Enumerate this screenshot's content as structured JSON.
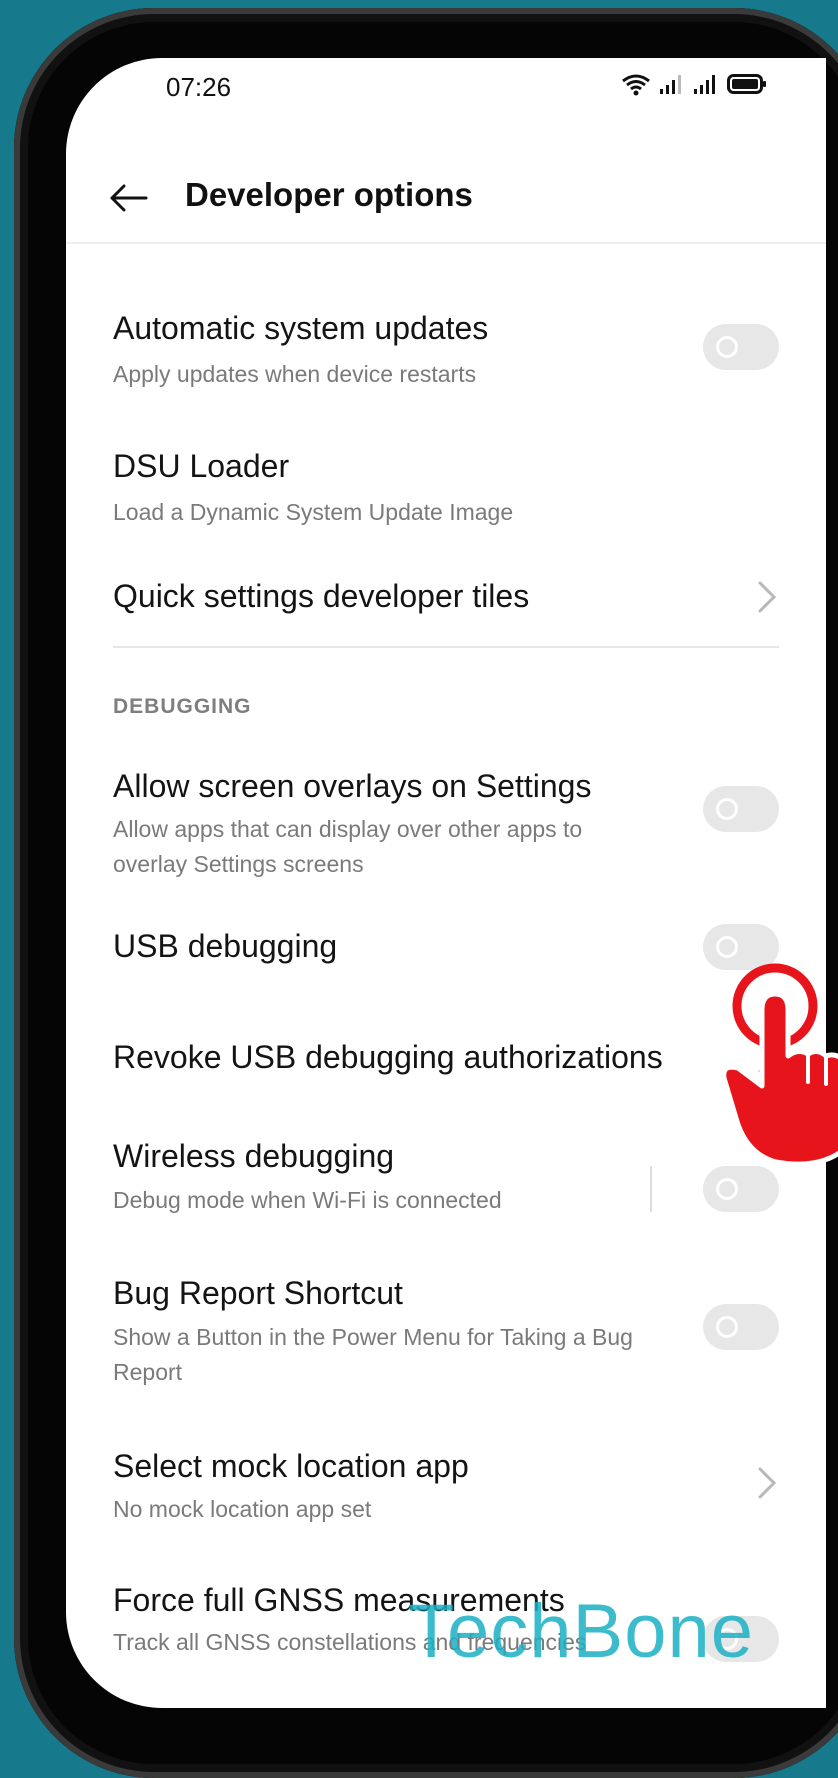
{
  "status_bar": {
    "time": "07:26",
    "icons": [
      "wifi-icon",
      "signal-icon",
      "signal-icon",
      "battery-icon"
    ]
  },
  "app_bar": {
    "back_icon": "back-arrow-icon",
    "title": "Developer options"
  },
  "items_top": [
    {
      "title": "Automatic system updates",
      "subtitle": "Apply updates when device restarts",
      "control": "toggle",
      "on": false
    },
    {
      "title": "DSU Loader",
      "subtitle": "Load a Dynamic System Update Image",
      "control": "none"
    },
    {
      "title": "Quick settings developer tiles",
      "subtitle": "",
      "control": "chevron"
    }
  ],
  "debugging": {
    "header": "DEBUGGING",
    "items": [
      {
        "title": "Allow screen overlays on Settings",
        "subtitle": "Allow apps that can display over other apps to overlay Settings screens",
        "control": "toggle",
        "on": false
      },
      {
        "title": "USB debugging",
        "subtitle": "",
        "control": "toggle",
        "on": false
      },
      {
        "title": "Revoke USB debugging authorizations",
        "subtitle": "",
        "control": "chevron"
      },
      {
        "title": "Wireless debugging",
        "subtitle": "Debug mode when Wi-Fi is connected",
        "control": "toggle",
        "on": false
      },
      {
        "title": "Bug Report Shortcut",
        "subtitle": "Show a Button in the Power Menu for Taking a Bug Report",
        "control": "toggle",
        "on": false
      },
      {
        "title": "Select mock location app",
        "subtitle": "No mock location app set",
        "control": "chevron"
      },
      {
        "title": "Force full GNSS measurements",
        "subtitle": "Track all GNSS constellations and frequencies",
        "control": "toggle",
        "on": false
      }
    ]
  },
  "overlays": {
    "watermark": "TechBone",
    "tap_indicator_icon": "tap-hand-icon"
  },
  "colors": {
    "background": "#167a8c",
    "toggle_off": "#e7e7e7",
    "tap_hand": "#e8141b",
    "watermark": "#1ab0c4"
  }
}
